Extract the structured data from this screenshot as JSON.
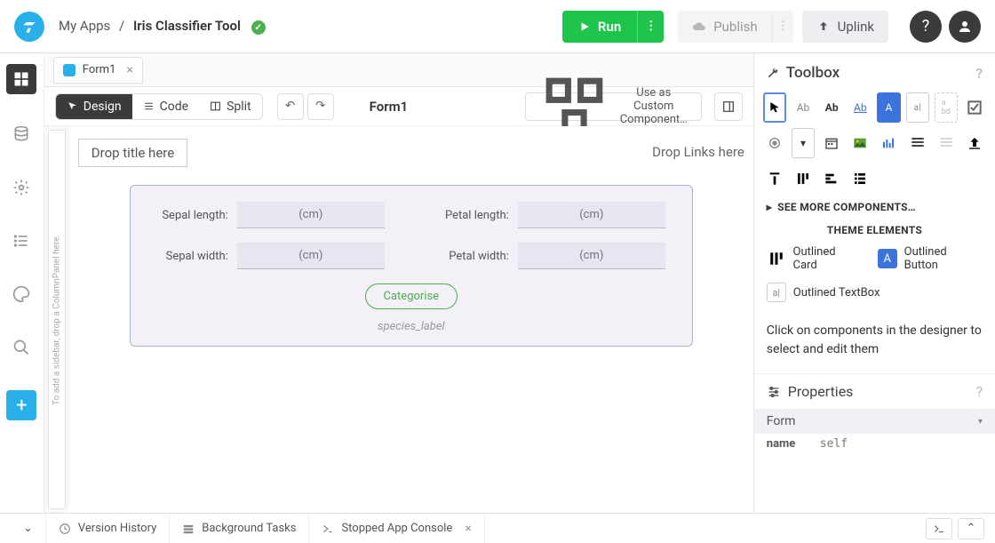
{
  "breadcrumb": {
    "root": "My Apps",
    "app": "Iris Classifier Tool"
  },
  "run_label": "Run",
  "publish_label": "Publish",
  "uplink_label": "Uplink",
  "tab": {
    "label": "Form1"
  },
  "modes": {
    "design": "Design",
    "code": "Code",
    "split": "Split"
  },
  "form_name": "Form1",
  "custom_comp_label": "Use as Custom Component…",
  "canvas": {
    "title_ph": "Drop title here",
    "links_ph": "Drop Links here",
    "sidebar_ph": "To add a sidebar, drop a ColumnPanel here.",
    "fields": {
      "sepal_length_label": "Sepal length:",
      "sepal_width_label": "Sepal width:",
      "petal_length_label": "Petal length:",
      "petal_width_label": "Petal width:",
      "unit_ph": "(cm)"
    },
    "categorise_label": "Categorise",
    "species_ph": "species_label"
  },
  "toolbox": {
    "title": "Toolbox",
    "see_more": "SEE MORE COMPONENTS…",
    "theme_header": "THEME ELEMENTS",
    "theme_items": {
      "card": "Outlined Card",
      "button": "Outlined Button",
      "textbox": "Outlined TextBox"
    },
    "hint": "Click on components in the designer to select and edit them"
  },
  "properties": {
    "title": "Properties",
    "section": "Form",
    "rows": {
      "name_key": "name",
      "name_val": "self"
    }
  },
  "bottombar": {
    "version": "Version History",
    "bg": "Background Tasks",
    "console": "Stopped App Console"
  }
}
